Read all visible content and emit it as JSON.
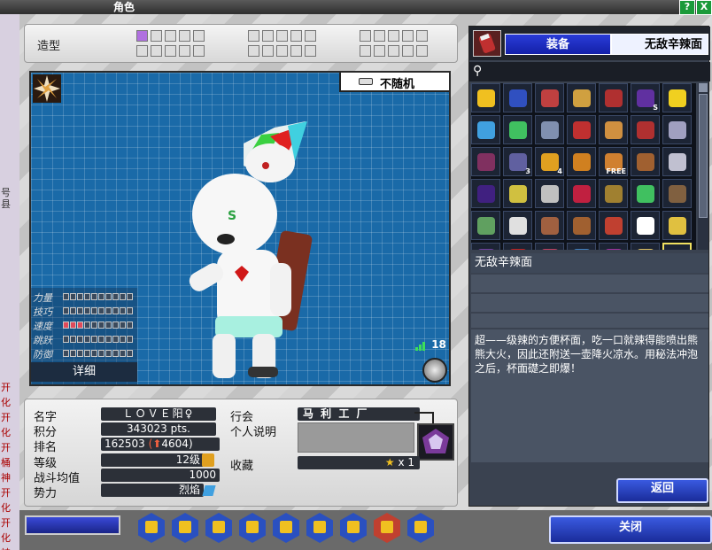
{
  "window": {
    "title": "角色",
    "help_label": "?",
    "close_label": "X"
  },
  "side_strip": {
    "lines": [
      "号县",
      "开",
      "化",
      "开",
      "化",
      "开",
      "桶",
      "神",
      "开",
      "化",
      "开",
      "化",
      "神"
    ]
  },
  "style": {
    "label": "造型"
  },
  "preview": {
    "random_label": "不随机",
    "detail_label": "详细",
    "signal_value": "18",
    "stats": [
      {
        "label": "力量",
        "level": 0
      },
      {
        "label": "技巧",
        "level": 0
      },
      {
        "label": "速度",
        "level": 3
      },
      {
        "label": "跳跃",
        "level": 0
      },
      {
        "label": "防御",
        "level": 0
      }
    ]
  },
  "profile": {
    "name_label": "名字",
    "name_value": "ＬＯＶＥ阳♀",
    "score_label": "积分",
    "score_value": "343023 pts.",
    "rank_label": "排名",
    "rank_value": "162503",
    "rank_change": "4604",
    "level_label": "等级",
    "level_value": "12级",
    "power_label": "战斗均值",
    "power_value": "1000",
    "force_label": "势力",
    "force_value": "烈焰",
    "guild_label": "行会",
    "guild_value": "马 利 工 厂",
    "bio_label": "个人说明",
    "bio_value": "",
    "collect_label": "收藏",
    "collect_value": "x 1"
  },
  "equipment": {
    "tab_label": "装备",
    "selected_name": "无敌辛辣面",
    "search_value": "",
    "item_badges": [
      "S",
      "3",
      "4",
      "FREE"
    ],
    "description": "超——级辣的方便杯面，吃一口就辣得能喷出熊熊大火，因此还附送一壶降火凉水。用秘法冲泡之后，杯面礎之即爆！",
    "back_label": "返回"
  },
  "footer": {
    "close_label": "关闭"
  },
  "colors": {
    "accent_blue": "#2a3cd8",
    "preview_bg": "#1a6aa8",
    "panel_dark": "#3a4250"
  }
}
